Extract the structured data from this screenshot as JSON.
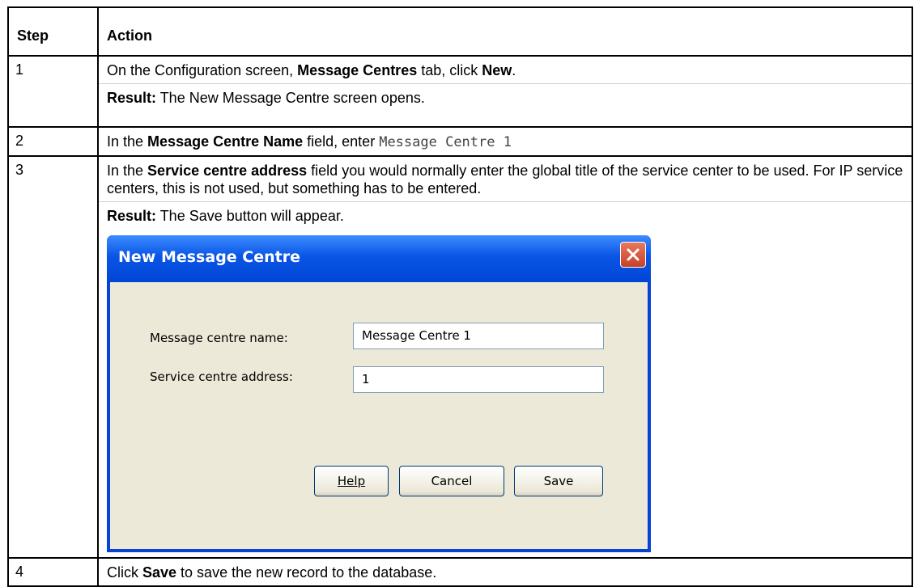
{
  "table": {
    "header_step": "Step",
    "header_action": "Action"
  },
  "rows": {
    "r1": {
      "step": "1",
      "l1_a": "On the Configuration screen, ",
      "l1_b": "Message Centres",
      "l1_c": " tab, click ",
      "l1_d": "New",
      "l1_e": ".",
      "l2_a": "Result:",
      "l2_b": " The New Message Centre screen opens."
    },
    "r2": {
      "step": "2",
      "a": "In the ",
      "b": "Message Centre Name",
      "c": " field, enter ",
      "code": "Message Centre 1"
    },
    "r3": {
      "step": "3",
      "a": "In the ",
      "b": "Service centre address",
      "c": " field you would normally enter the global title of the service center to be used. For IP service centers, this is not used, but something has to be entered.",
      "res_a": "Result:",
      "res_b": " The Save button will appear."
    },
    "r4": {
      "step": "4",
      "a": "Click ",
      "b": "Save",
      "c": " to save the new record to the database."
    }
  },
  "dialog": {
    "title": "New Message Centre",
    "name_label": "Message centre name:",
    "name_value": "Message Centre 1",
    "address_label": "Service centre address:",
    "address_value": "1",
    "help_label": "Help",
    "cancel_label": "Cancel",
    "save_label": "Save",
    "close_icon": "close-icon"
  }
}
